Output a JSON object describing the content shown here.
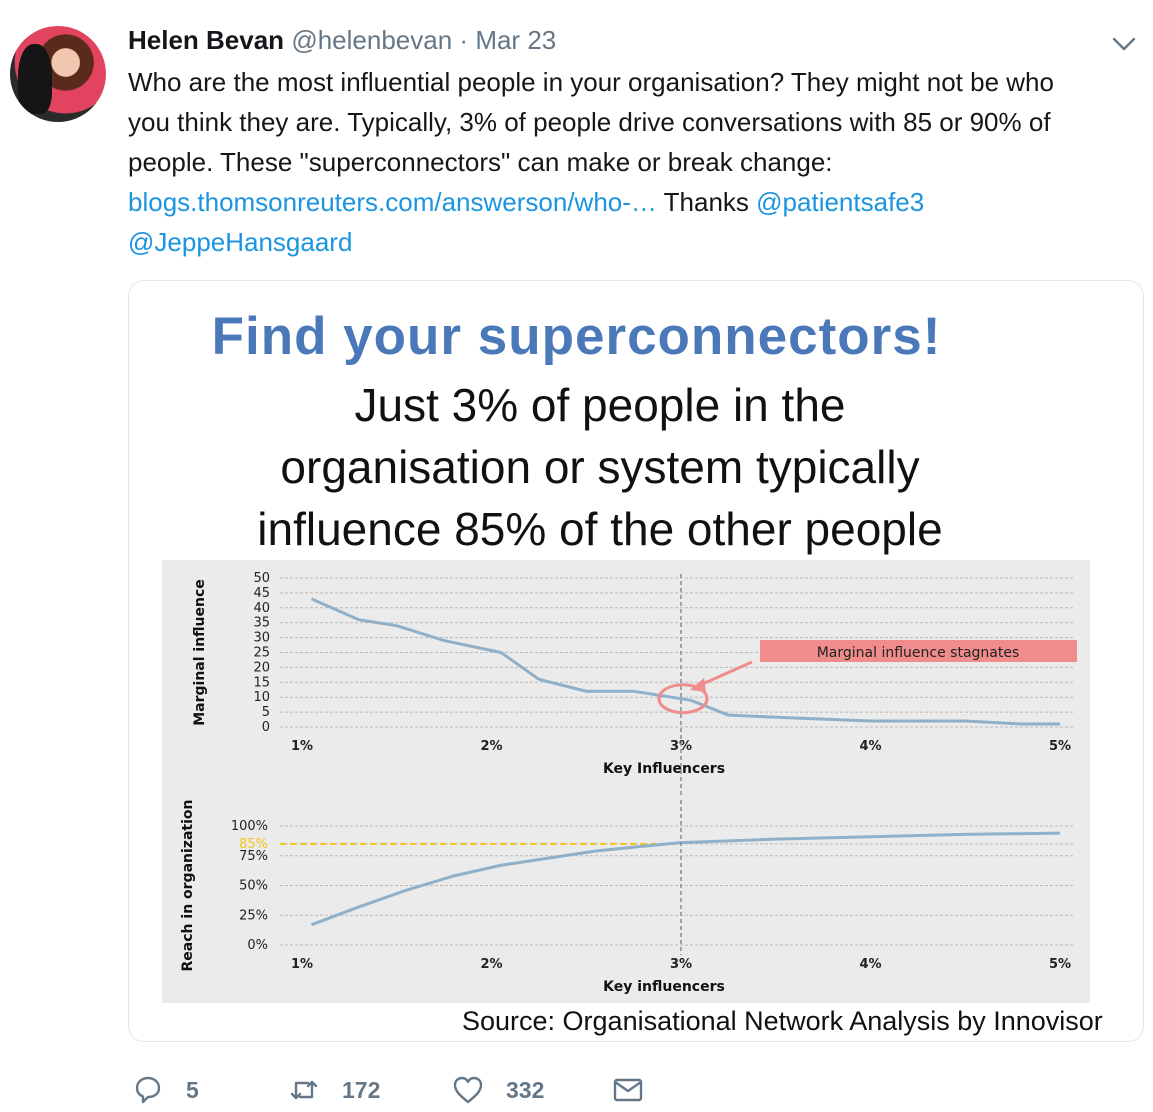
{
  "tweet": {
    "author_name": "Helen Bevan",
    "handle": "@helenbevan",
    "separator": "·",
    "date": "Mar 23",
    "text_line1": "Who are the most influential people in your organisation? They might not be who",
    "text_line2": "you think they are. Typically, 3% of people drive conversations with 85 or 90% of",
    "text_line3": "people. These \"superconnectors\" can make or break change:",
    "link_text": "blogs.thomsonreuters.com/answerson/who-…",
    "thanks_text": " Thanks ",
    "mention1": "@patientsafe3",
    "mention2": "@JeppeHansgaard"
  },
  "card": {
    "title": "Find your superconnectors!",
    "subtitle_line1": "Just 3% of people in the",
    "subtitle_line2": "organisation or system typically",
    "subtitle_line3": "influence 85% of the other people",
    "source": "Source: Organisational Network Analysis by Innovisor"
  },
  "actions": {
    "replies": "5",
    "retweets": "172",
    "likes": "332"
  },
  "icons": {
    "reply": "reply-icon",
    "retweet": "retweet-icon",
    "like": "heart-icon",
    "message": "envelope-icon",
    "caret": "chevron-down-icon"
  },
  "colors": {
    "link": "#1b95e0",
    "title_blue": "#4a78b8",
    "series_line": "#8fb0c8",
    "annotation_red": "#f08c8c",
    "highlight_yellow": "#f2c318"
  },
  "chart_data": [
    {
      "type": "line",
      "xlabel": "Key Influencers",
      "ylabel": "Marginal influence",
      "x_ticks": [
        "1%",
        "2%",
        "3%",
        "4%",
        "5%"
      ],
      "y_ticks": [
        "0",
        "5",
        "10",
        "15",
        "20",
        "25",
        "30",
        "35",
        "40",
        "45",
        "50"
      ],
      "ylim": [
        0,
        50
      ],
      "xlim": [
        1,
        5
      ],
      "grid": true,
      "annotation": "Marginal influence stagnates",
      "marker_x": 3,
      "series": [
        {
          "x": [
            1.05,
            1.3,
            1.5,
            1.75,
            2.05,
            2.25,
            2.5,
            2.75,
            2.95,
            3.05,
            3.25,
            3.6,
            4.0,
            4.5,
            4.8,
            5.0
          ],
          "values": [
            43,
            36,
            34,
            29,
            25,
            16,
            12,
            12,
            10,
            9,
            4,
            3,
            2,
            2,
            1,
            1
          ]
        }
      ]
    },
    {
      "type": "line",
      "xlabel": "Key influencers",
      "ylabel": "Reach in organization",
      "x_ticks": [
        "1%",
        "2%",
        "3%",
        "4%",
        "5%"
      ],
      "y_ticks": [
        "0%",
        "25%",
        "50%",
        "75%",
        "85%",
        "100%"
      ],
      "highlight_tick": "85%",
      "ylim": [
        0,
        100
      ],
      "xlim": [
        1,
        5
      ],
      "grid": true,
      "marker_x": 3,
      "reference_y": 85,
      "series": [
        {
          "x": [
            1.05,
            1.3,
            1.55,
            1.8,
            2.05,
            2.3,
            2.55,
            2.8,
            3.0,
            3.5,
            4.0,
            4.5,
            5.0
          ],
          "values": [
            17,
            32,
            46,
            58,
            67,
            73,
            79,
            83,
            86,
            89,
            91,
            93,
            94
          ]
        }
      ]
    }
  ]
}
